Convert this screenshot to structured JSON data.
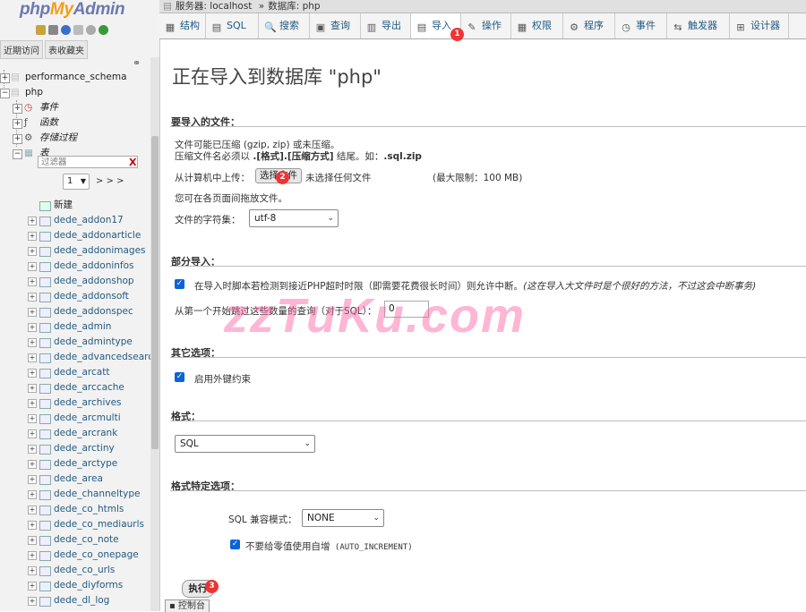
{
  "sidebar": {
    "logo": {
      "part1": "php",
      "part2": "My",
      "part3": "Admin"
    },
    "tabs": [
      "近期访问",
      "表收藏夹"
    ],
    "databases": [
      {
        "name": "performance_schema"
      },
      {
        "name": "php"
      }
    ],
    "php_children": [
      "事件",
      "函数",
      "存储过程",
      "表"
    ],
    "filter_placeholder": "过滤器",
    "filter_clear": "X",
    "page_value": "1",
    "page_next": "> > >",
    "new_label": "新建",
    "tables": [
      "dede_addon17",
      "dede_addonarticle",
      "dede_addonimages",
      "dede_addoninfos",
      "dede_addonshop",
      "dede_addonsoft",
      "dede_addonspec",
      "dede_admin",
      "dede_admintype",
      "dede_advancedsearch",
      "dede_arcatt",
      "dede_arccache",
      "dede_archives",
      "dede_arcmulti",
      "dede_arcrank",
      "dede_arctiny",
      "dede_arctype",
      "dede_area",
      "dede_channeltype",
      "dede_co_htmls",
      "dede_co_mediaurls",
      "dede_co_note",
      "dede_co_onepage",
      "dede_co_urls",
      "dede_diyforms",
      "dede_dl_log"
    ]
  },
  "breadcrumb": {
    "server": "服务器: localhost",
    "sep": "»",
    "database": "数据库: php"
  },
  "tabs": [
    {
      "label": "结构",
      "icon": "▦"
    },
    {
      "label": "SQL",
      "icon": "▤"
    },
    {
      "label": "搜索",
      "icon": "🔍"
    },
    {
      "label": "查询",
      "icon": "▣"
    },
    {
      "label": "导出",
      "icon": "▥"
    },
    {
      "label": "导入",
      "icon": "▤"
    },
    {
      "label": "操作",
      "icon": "✎"
    },
    {
      "label": "权限",
      "icon": "▦"
    },
    {
      "label": "程序",
      "icon": "⚙"
    },
    {
      "label": "事件",
      "icon": "◷"
    },
    {
      "label": "触发器",
      "icon": "⇆"
    },
    {
      "label": "设计器",
      "icon": "⊞"
    }
  ],
  "badges": [
    "1",
    "2",
    "3"
  ],
  "page_title": "正在导入到数据库 \"php\"",
  "file_section": {
    "heading": "要导入的文件：",
    "line1": "文件可能已压缩 (gzip, zip) 或未压缩。",
    "line2_a": "压缩文件名必须以 ",
    "line2_b": ".[格式].[压缩方式]",
    "line2_c": " 结尾。如：",
    "line2_d": ".sql.zip",
    "upload_label": "从计算机中上传：",
    "choose_file_button": "选择文件",
    "no_file_text": "未选择任何文件",
    "max_limit": "(最大限制：100 MB)",
    "drag_hint": "您可在各页面间拖放文件。",
    "charset_label": "文件的字符集：",
    "charset_value": "utf-8"
  },
  "partial_section": {
    "heading": "部分导入：",
    "allow_interrupt_a": "在导入时脚本若检测到接近PHP超时时限（即需要花费很长时间）则允许中断。",
    "allow_interrupt_b": "(这在导入大文件时是个很好的方法，不过这会中断事务)",
    "skip_label": "从第一个开始跳过这些数量的查询（对于SQL）：",
    "skip_value": "0"
  },
  "other_section": {
    "heading": "其它选项：",
    "fk_label": "启用外键约束"
  },
  "format_section": {
    "heading": "格式：",
    "format_value": "SQL"
  },
  "format_specific_section": {
    "heading": "格式特定选项：",
    "compat_label": "SQL 兼容模式：",
    "compat_value": "NONE",
    "no_auto_value_a": "不要给零值使用自增",
    "no_auto_value_b": " (AUTO_INCREMENT)"
  },
  "go_button": "执行",
  "console_label": "控制台",
  "watermark": "zzTuKu.com"
}
